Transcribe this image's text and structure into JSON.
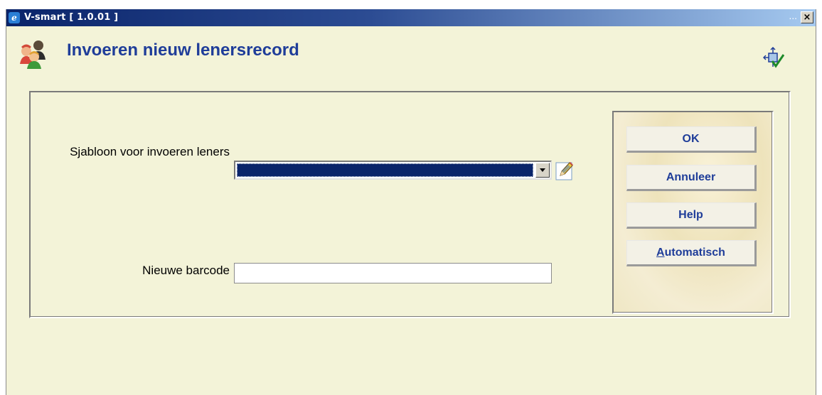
{
  "window": {
    "title": "V-smart [ 1.0.01 ]",
    "dots": "...",
    "close_glyph": "×",
    "app_icon": "e"
  },
  "header": {
    "title": "Invoeren nieuw lenersrecord",
    "icon": "users-icon",
    "tool_icon": "move-check-icon"
  },
  "form": {
    "template_label": "Sjabloon voor invoeren leners",
    "template_value": "",
    "barcode_label": "Nieuwe barcode",
    "barcode_value": ""
  },
  "buttons": {
    "ok": "OK",
    "cancel": "Annuleer",
    "help": "Help",
    "auto_first": "A",
    "auto_rest": "utomatisch"
  },
  "colors": {
    "title": "#1f3d99",
    "background": "#f3f3d8",
    "selection": "#0a246a"
  }
}
